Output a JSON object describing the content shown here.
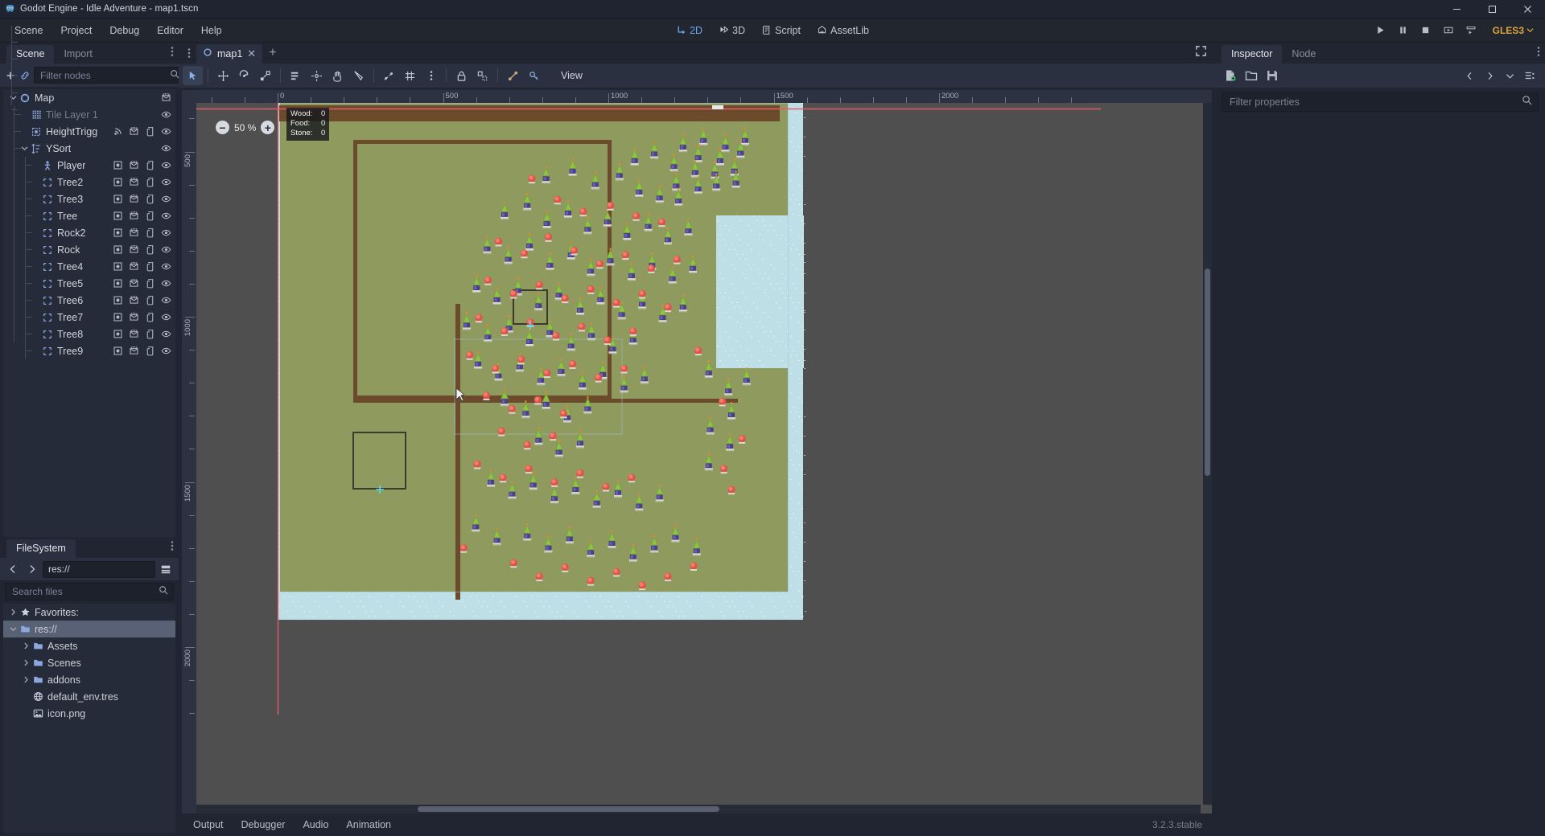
{
  "window": {
    "title": "Godot Engine - Idle Adventure - map1.tscn",
    "icon": "godot-robot-icon",
    "buttons": {
      "minimize": "minimize-icon",
      "maximize": "maximize-icon",
      "close": "close-icon"
    }
  },
  "menubar": {
    "items": [
      "Scene",
      "Project",
      "Debug",
      "Editor",
      "Help"
    ],
    "modes": [
      {
        "label": "2D",
        "icon": "2d-icon",
        "active": true
      },
      {
        "label": "3D",
        "icon": "3d-icon",
        "active": false
      },
      {
        "label": "Script",
        "icon": "script-icon",
        "active": false
      },
      {
        "label": "AssetLib",
        "icon": "assetlib-icon",
        "active": false
      }
    ],
    "playback": [
      "play-icon",
      "pause-icon",
      "stop-icon",
      "play-scene-icon",
      "play-custom-icon"
    ],
    "renderer": "GLES3"
  },
  "scene_dock": {
    "tabs": [
      {
        "label": "Scene",
        "active": true
      },
      {
        "label": "Import",
        "active": false
      }
    ],
    "toolbar": {
      "add_icon": "add-node-icon",
      "link_icon": "instance-scene-icon"
    },
    "filter": {
      "placeholder": "Filter nodes",
      "value": "",
      "icon": "search-icon"
    },
    "nodes": [
      {
        "label": "Map",
        "icon": "node2d-icon",
        "depth": 0,
        "expanded": true,
        "dim": false,
        "buttons": [
          "scene-icon"
        ]
      },
      {
        "label": "Tile Layer 1",
        "icon": "tilemap-icon",
        "depth": 1,
        "expanded": null,
        "dim": true,
        "buttons": [
          "visibility-icon"
        ]
      },
      {
        "label": "HeightTrigg",
        "icon": "area2d-icon",
        "depth": 1,
        "expanded": null,
        "dim": false,
        "buttons": [
          "signal-icon",
          "scene-icon",
          "script-icon",
          "visibility-icon"
        ]
      },
      {
        "label": "YSort",
        "icon": "ysort-icon",
        "depth": 1,
        "expanded": true,
        "dim": false,
        "buttons": [
          "visibility-icon"
        ]
      },
      {
        "label": "Player",
        "icon": "kinematicbody2d-icon",
        "depth": 2,
        "expanded": null,
        "dim": false,
        "buttons": [
          "unique-icon",
          "scene-icon",
          "script-icon",
          "visibility-icon"
        ]
      },
      {
        "label": "Tree2",
        "icon": "instance-icon",
        "depth": 2,
        "expanded": null,
        "dim": false,
        "buttons": [
          "unique-icon",
          "scene-icon",
          "script-icon",
          "visibility-icon"
        ]
      },
      {
        "label": "Tree3",
        "icon": "instance-icon",
        "depth": 2,
        "expanded": null,
        "dim": false,
        "buttons": [
          "unique-icon",
          "scene-icon",
          "script-icon",
          "visibility-icon"
        ]
      },
      {
        "label": "Tree",
        "icon": "instance-icon",
        "depth": 2,
        "expanded": null,
        "dim": false,
        "buttons": [
          "unique-icon",
          "scene-icon",
          "script-icon",
          "visibility-icon"
        ]
      },
      {
        "label": "Rock2",
        "icon": "instance-icon",
        "depth": 2,
        "expanded": null,
        "dim": false,
        "buttons": [
          "unique-icon",
          "scene-icon",
          "script-icon",
          "visibility-icon"
        ]
      },
      {
        "label": "Rock",
        "icon": "instance-icon",
        "depth": 2,
        "expanded": null,
        "dim": false,
        "buttons": [
          "unique-icon",
          "scene-icon",
          "script-icon",
          "visibility-icon"
        ]
      },
      {
        "label": "Tree4",
        "icon": "instance-icon",
        "depth": 2,
        "expanded": null,
        "dim": false,
        "buttons": [
          "unique-icon",
          "scene-icon",
          "script-icon",
          "visibility-icon"
        ]
      },
      {
        "label": "Tree5",
        "icon": "instance-icon",
        "depth": 2,
        "expanded": null,
        "dim": false,
        "buttons": [
          "unique-icon",
          "scene-icon",
          "script-icon",
          "visibility-icon"
        ]
      },
      {
        "label": "Tree6",
        "icon": "instance-icon",
        "depth": 2,
        "expanded": null,
        "dim": false,
        "buttons": [
          "unique-icon",
          "scene-icon",
          "script-icon",
          "visibility-icon"
        ]
      },
      {
        "label": "Tree7",
        "icon": "instance-icon",
        "depth": 2,
        "expanded": null,
        "dim": false,
        "buttons": [
          "unique-icon",
          "scene-icon",
          "script-icon",
          "visibility-icon"
        ]
      },
      {
        "label": "Tree8",
        "icon": "instance-icon",
        "depth": 2,
        "expanded": null,
        "dim": false,
        "buttons": [
          "unique-icon",
          "scene-icon",
          "script-icon",
          "visibility-icon"
        ]
      },
      {
        "label": "Tree9",
        "icon": "instance-icon",
        "depth": 2,
        "expanded": null,
        "dim": false,
        "buttons": [
          "unique-icon",
          "scene-icon",
          "script-icon",
          "visibility-icon"
        ]
      }
    ]
  },
  "filesystem_dock": {
    "tabs": [
      {
        "label": "FileSystem",
        "active": true
      }
    ],
    "nav": {
      "back_icon": "chevron-left-icon",
      "forward_icon": "chevron-right-icon",
      "path": "res://",
      "layout_icon": "split-mode-icon"
    },
    "search": {
      "placeholder": "Search files",
      "value": "",
      "icon": "search-icon"
    },
    "entries": [
      {
        "label": "Favorites:",
        "icon": "star-icon",
        "depth": 0,
        "expanded": false,
        "type": "group",
        "selected": false
      },
      {
        "label": "res://",
        "icon": "folder-icon",
        "depth": 0,
        "expanded": true,
        "type": "folder",
        "selected": true
      },
      {
        "label": "Assets",
        "icon": "folder-icon",
        "depth": 1,
        "expanded": false,
        "type": "folder",
        "selected": false
      },
      {
        "label": "Scenes",
        "icon": "folder-icon",
        "depth": 1,
        "expanded": false,
        "type": "folder",
        "selected": false
      },
      {
        "label": "addons",
        "icon": "folder-icon",
        "depth": 1,
        "expanded": false,
        "type": "folder",
        "selected": false
      },
      {
        "label": "default_env.tres",
        "icon": "environment-resource-icon",
        "depth": 1,
        "expanded": null,
        "type": "file",
        "selected": false
      },
      {
        "label": "icon.png",
        "icon": "image-file-icon",
        "depth": 1,
        "expanded": null,
        "type": "file",
        "selected": false
      }
    ]
  },
  "viewport": {
    "tabs": [
      {
        "label": "map1",
        "icon": "node2d-icon",
        "active": true,
        "close_icon": "close-icon"
      }
    ],
    "add_tab_icon": "plus-icon",
    "fullscreen_icon": "distraction-free-icon",
    "toolbar": {
      "tools": [
        {
          "name": "select-mode-tool",
          "icon": "cursor-arrow-icon",
          "active": true
        },
        {
          "name": "move-mode-tool",
          "icon": "move-icon",
          "active": false
        },
        {
          "name": "rotate-mode-tool",
          "icon": "rotate-icon",
          "active": false
        },
        {
          "name": "scale-mode-tool",
          "icon": "scale-icon",
          "active": false
        },
        {
          "name": "list-select-tool",
          "icon": "list-select-icon",
          "active": false
        },
        {
          "name": "pivot-tool",
          "icon": "pivot-icon",
          "active": false
        },
        {
          "name": "pan-mode-tool",
          "icon": "hand-icon",
          "active": false
        },
        {
          "name": "ruler-mode-tool",
          "icon": "ruler-icon",
          "active": false
        },
        {
          "name": "smart-snap-tool",
          "icon": "smart-snap-icon",
          "active": false
        },
        {
          "name": "grid-snap-tool",
          "icon": "grid-snap-icon",
          "active": false
        },
        {
          "name": "snap-options-tool",
          "icon": "vertical-dots-icon",
          "active": false
        },
        {
          "name": "lock-tool",
          "icon": "lock-icon",
          "active": false
        },
        {
          "name": "group-tool",
          "icon": "group-icon",
          "active": false
        },
        {
          "name": "skeleton-options-tool",
          "icon": "bone-icon",
          "active": false
        },
        {
          "name": "animation-key-tool",
          "icon": "key-icon",
          "active": false
        }
      ],
      "view_menu": "View"
    },
    "zoom": {
      "minus": "−",
      "plus": "+",
      "value": "50 %"
    },
    "stats": [
      {
        "label": "Wood:",
        "value": "0"
      },
      {
        "label": "Food:",
        "value": "0"
      },
      {
        "label": "Stone:",
        "value": "0"
      }
    ],
    "ruler_h_labels": [
      "0",
      "500",
      "1000",
      "1500"
    ],
    "ruler_v_labels": [
      "500",
      "1000",
      "1500"
    ]
  },
  "inspector_dock": {
    "tabs": [
      {
        "label": "Inspector",
        "active": true
      },
      {
        "label": "Node",
        "active": false
      }
    ],
    "toolbar": [
      "new-resource-icon",
      "open-resource-icon",
      "save-resource-icon"
    ],
    "nav": [
      "history-prev-icon",
      "history-next-icon",
      "history-menu-icon",
      "object-menu-icon"
    ],
    "filter": {
      "placeholder": "Filter properties",
      "value": "",
      "icon": "search-icon"
    }
  },
  "bottom_panel": {
    "tabs": [
      "Output",
      "Debugger",
      "Audio",
      "Animation"
    ],
    "version": "3.2.3.stable"
  },
  "colors": {
    "accent": "#6ca3e8",
    "renderer_text": "#d9a441",
    "panel_bg": "#202531",
    "dock_bg": "#2a3040",
    "tree_bg": "#252b38",
    "selection": "#596274",
    "grass": "#8f9a5e",
    "water": "#bfdfe6",
    "dirt": "#6b4b2b",
    "canvas_bg": "#4f4f4f"
  }
}
